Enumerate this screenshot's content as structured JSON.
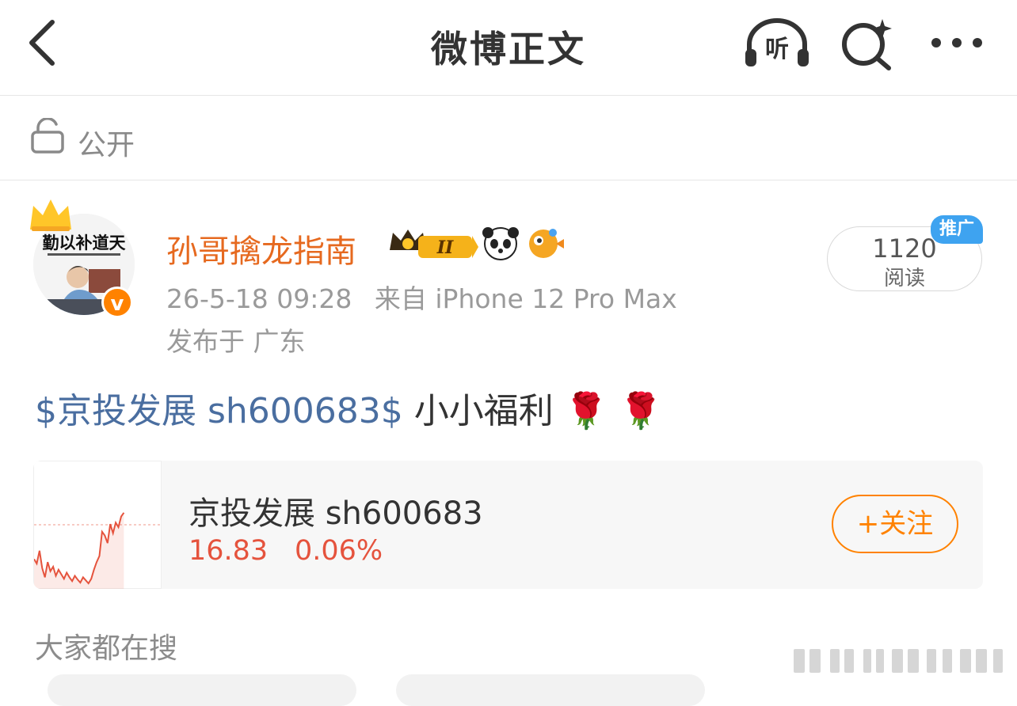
{
  "nav": {
    "title": "微博正文",
    "listen_label": "听"
  },
  "visibility": {
    "label": "公开"
  },
  "author": {
    "name": "孙哥擒龙指南",
    "avatar_text": "勤以补道天",
    "level": "II",
    "time": "26-5-18 09:28",
    "source": "来自 iPhone 12 Pro Max",
    "location": "发布于 广东"
  },
  "stats": {
    "reads": "1120",
    "reads_label": "阅读",
    "promo_badge": "推广"
  },
  "post": {
    "topic": "$京投发展 sh600683$",
    "text": " 小小福利",
    "emoji": "🌹 🌹"
  },
  "stock_card": {
    "name": "京投发展 sh600683",
    "price": "16.83",
    "change": "0.06%",
    "follow_label": "+关注",
    "line_color": "#e5533d",
    "mini_chart": [
      0.66,
      0.72,
      0.55,
      0.78,
      0.9,
      0.7,
      0.82,
      0.76,
      0.88,
      0.8,
      0.86,
      0.92,
      0.84,
      0.9,
      0.95,
      0.88,
      0.93,
      0.97,
      0.9,
      0.94,
      0.98,
      0.92,
      0.8,
      0.7,
      0.62,
      0.3,
      0.35,
      0.45,
      0.2,
      0.32,
      0.18,
      0.24,
      0.1,
      0.05
    ]
  },
  "discover": {
    "title": "大家都在搜"
  },
  "colors": {
    "accent": "#ff8200",
    "username": "#e6691f",
    "topic": "#4a6ea0",
    "stock_red": "#e5533d",
    "promo": "#3ea3f0"
  }
}
